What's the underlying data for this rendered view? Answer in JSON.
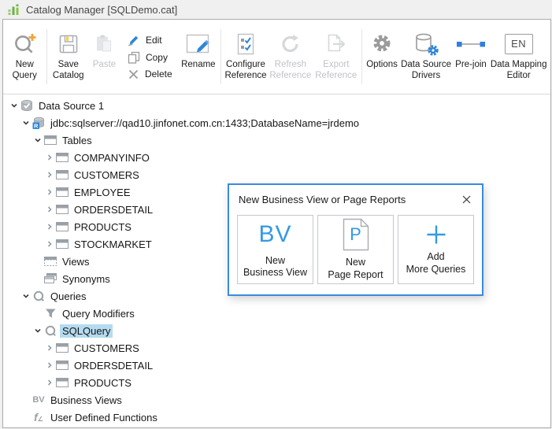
{
  "window": {
    "title": "Catalog Manager [SQLDemo.cat]"
  },
  "toolbar": {
    "new_query": "New Query",
    "save_catalog": "Save Catalog",
    "paste": "Paste",
    "edit": "Edit",
    "copy": "Copy",
    "delete": "Delete",
    "rename": "Rename",
    "configure_reference": "Configure Reference",
    "refresh_reference": "Refresh Reference",
    "export_reference": "Export Reference",
    "options": "Options",
    "data_source_drivers": "Data Source Drivers",
    "pre_join": "Pre-join",
    "data_mapping_editor": "Data Mapping Editor",
    "data_mapping_glyph": "EN"
  },
  "tree": {
    "glyph_business_views": "BV",
    "glyph_udf": "f",
    "items": [
      {
        "label": "Data Source 1"
      },
      {
        "label": "jdbc:sqlserver://qad10.jinfonet.com.cn:1433;DatabaseName=jrdemo"
      },
      {
        "label": "Tables"
      },
      {
        "label": "COMPANYINFO"
      },
      {
        "label": "CUSTOMERS"
      },
      {
        "label": "EMPLOYEE"
      },
      {
        "label": "ORDERSDETAIL"
      },
      {
        "label": "PRODUCTS"
      },
      {
        "label": "STOCKMARKET"
      },
      {
        "label": "Views"
      },
      {
        "label": "Synonyms"
      },
      {
        "label": "Queries"
      },
      {
        "label": "Query Modifiers"
      },
      {
        "label": "SQLQuery",
        "selected": true
      },
      {
        "label": "CUSTOMERS"
      },
      {
        "label": "ORDERSDETAIL"
      },
      {
        "label": "PRODUCTS"
      },
      {
        "label": "Business Views"
      },
      {
        "label": "User Defined Functions"
      }
    ]
  },
  "dialog": {
    "title": "New Business View or Page Reports",
    "buttons": [
      {
        "glyph": "BV",
        "line1": "New",
        "line2": "Business View"
      },
      {
        "glyph": "P",
        "line1": "New",
        "line2": "Page Report"
      },
      {
        "glyph": "+",
        "line1": "Add",
        "line2": "More Queries"
      }
    ]
  },
  "colors": {
    "accent_blue": "#2e86d9",
    "dialog_glyph_blue": "#3399e6",
    "logo_green": "#6ab04c",
    "plus_orange": "#f2a33a",
    "icon_gray": "#9b9b9b",
    "disabled_gray": "#d5d8db",
    "selection_blue": "#b5dbf0",
    "dialog_border": "#3a8bdc"
  }
}
